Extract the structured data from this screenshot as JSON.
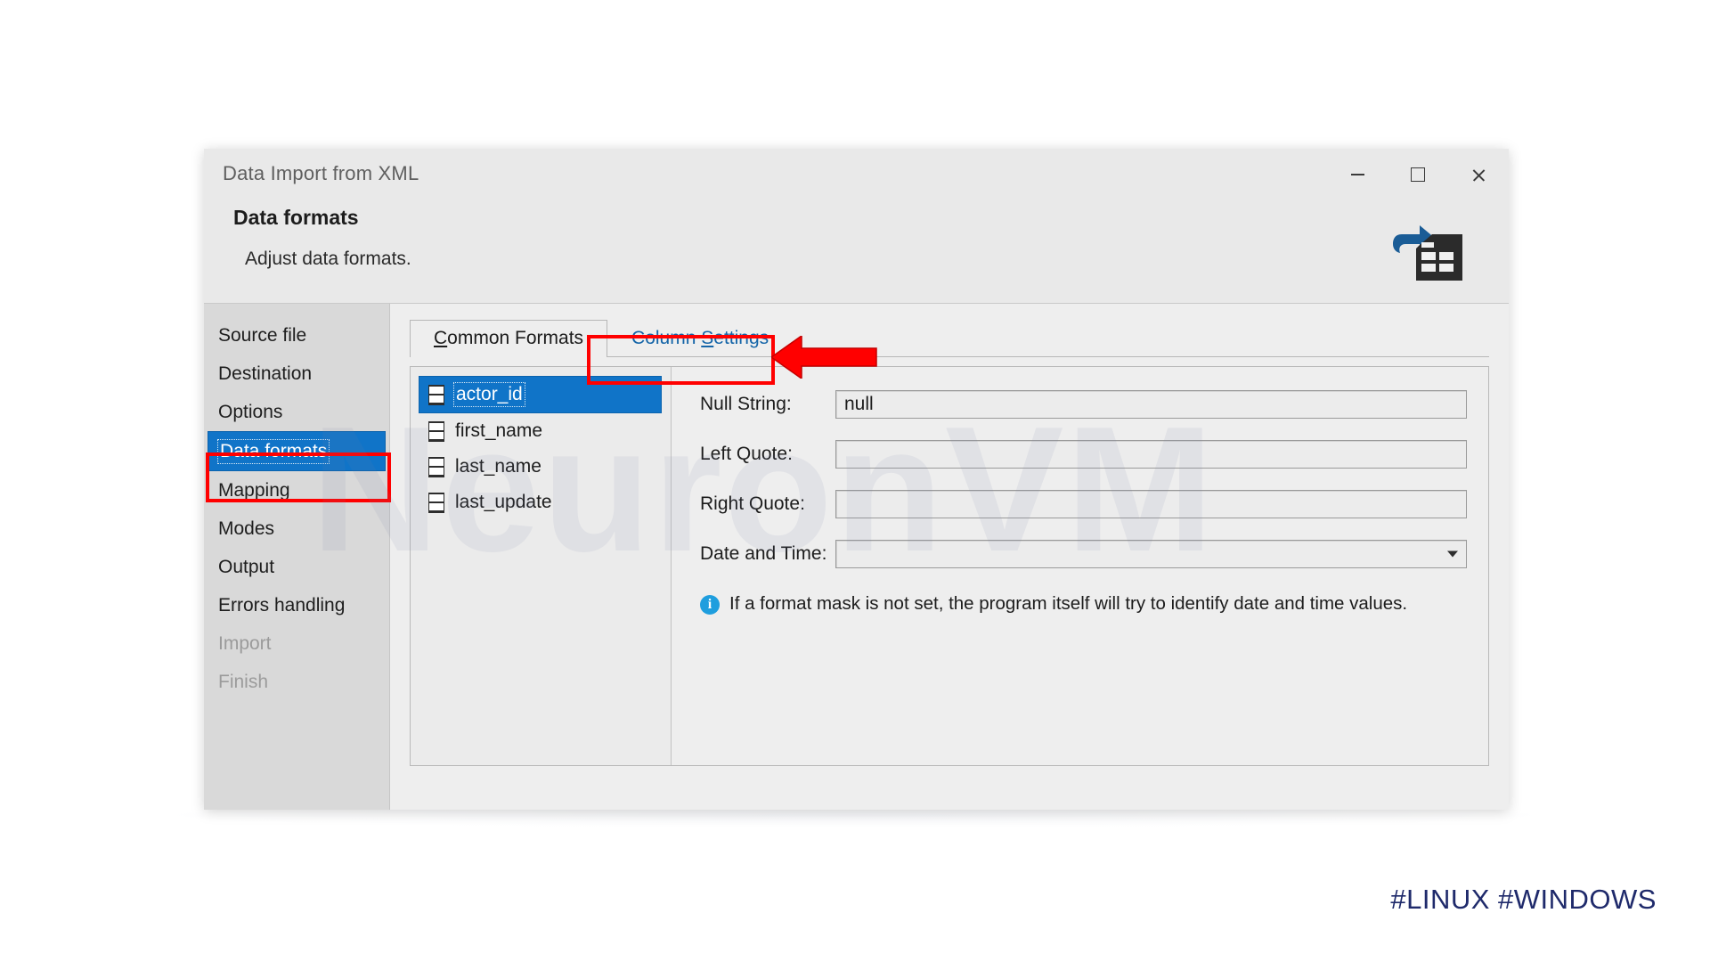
{
  "window": {
    "title": "Data Import from XML",
    "controls": {
      "minimize": "minimize",
      "maximize": "maximize",
      "close": "close"
    }
  },
  "header": {
    "title": "Data formats",
    "subtitle": "Adjust data formats.",
    "icon": "import-to-table-icon"
  },
  "sidebar": {
    "items": [
      {
        "label": "Source file",
        "state": "normal"
      },
      {
        "label": "Destination",
        "state": "normal"
      },
      {
        "label": "Options",
        "state": "normal"
      },
      {
        "label": "Data formats",
        "state": "active"
      },
      {
        "label": "Mapping",
        "state": "normal"
      },
      {
        "label": "Modes",
        "state": "normal"
      },
      {
        "label": "Output",
        "state": "normal"
      },
      {
        "label": "Errors handling",
        "state": "normal"
      },
      {
        "label": "Import",
        "state": "disabled"
      },
      {
        "label": "Finish",
        "state": "disabled"
      }
    ]
  },
  "tabs": [
    {
      "label": "Common Formats",
      "accel": "C",
      "active": true
    },
    {
      "label": "Column Settings",
      "accel": "S",
      "active": false
    }
  ],
  "columns": [
    {
      "name": "actor_id",
      "selected": true
    },
    {
      "name": "first_name",
      "selected": false
    },
    {
      "name": "last_name",
      "selected": false
    },
    {
      "name": "last_update",
      "selected": false
    }
  ],
  "form": {
    "fields": [
      {
        "label": "Null String:",
        "value": "null",
        "type": "text"
      },
      {
        "label": "Left Quote:",
        "value": "",
        "type": "text"
      },
      {
        "label": "Right Quote:",
        "value": "",
        "type": "text"
      },
      {
        "label": "Date and Time:",
        "value": "",
        "type": "combo"
      }
    ],
    "hint": "If a format mask is not set, the program itself will try to identify date and time values.",
    "hint_icon": "info-icon"
  },
  "annotations": {
    "sidebar_highlight": "Data formats",
    "tab_highlight": "Column Settings",
    "arrow": "left-arrow-annotation",
    "color": "#ff0000"
  },
  "watermark": "NeuronVM",
  "hashtags": "#LINUX #WINDOWS",
  "colors": {
    "accent": "#1074c8",
    "annotation": "#ff0000",
    "hashtag": "#1f2a6b",
    "info": "#1f9ede",
    "link": "#1565a8"
  }
}
